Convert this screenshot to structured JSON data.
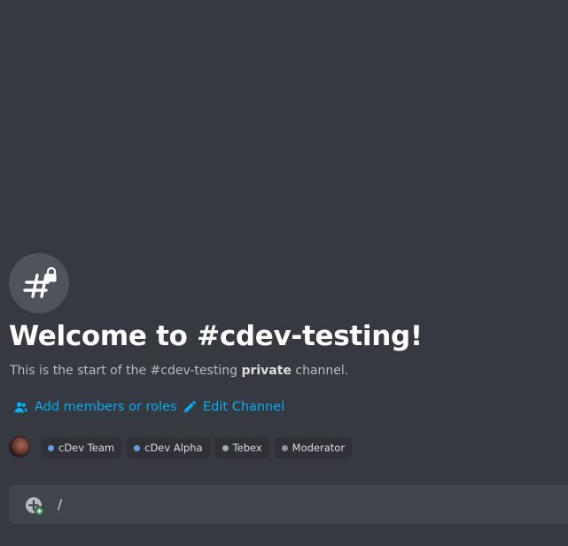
{
  "channel": {
    "icon": "hashtag-lock-icon",
    "welcome_title": "Welcome to #cdev-testing!",
    "subtitle_prefix": "This is the start of the #cdev-testing",
    "subtitle_emphasis": "private",
    "subtitle_suffix": "channel."
  },
  "actions": {
    "add_members": {
      "label": "Add members or roles",
      "icon": "add-member-icon"
    },
    "edit_channel": {
      "label": "Edit Channel",
      "icon": "pencil-icon"
    }
  },
  "members": {
    "roles": [
      {
        "name": "cDev Team",
        "color": "#5f9ee0"
      },
      {
        "name": "cDev Alpha",
        "color": "#5f9ee0"
      },
      {
        "name": "Tebex",
        "color": "#99aab5"
      },
      {
        "name": "Moderator",
        "color": "#8e9297"
      }
    ]
  },
  "composer": {
    "value": "/",
    "attach_icon": "plus-circle-icon"
  },
  "colors": {
    "background": "#36393f",
    "link": "#00aff4",
    "composer": "#40444b",
    "role_pill": "#2f3136"
  }
}
